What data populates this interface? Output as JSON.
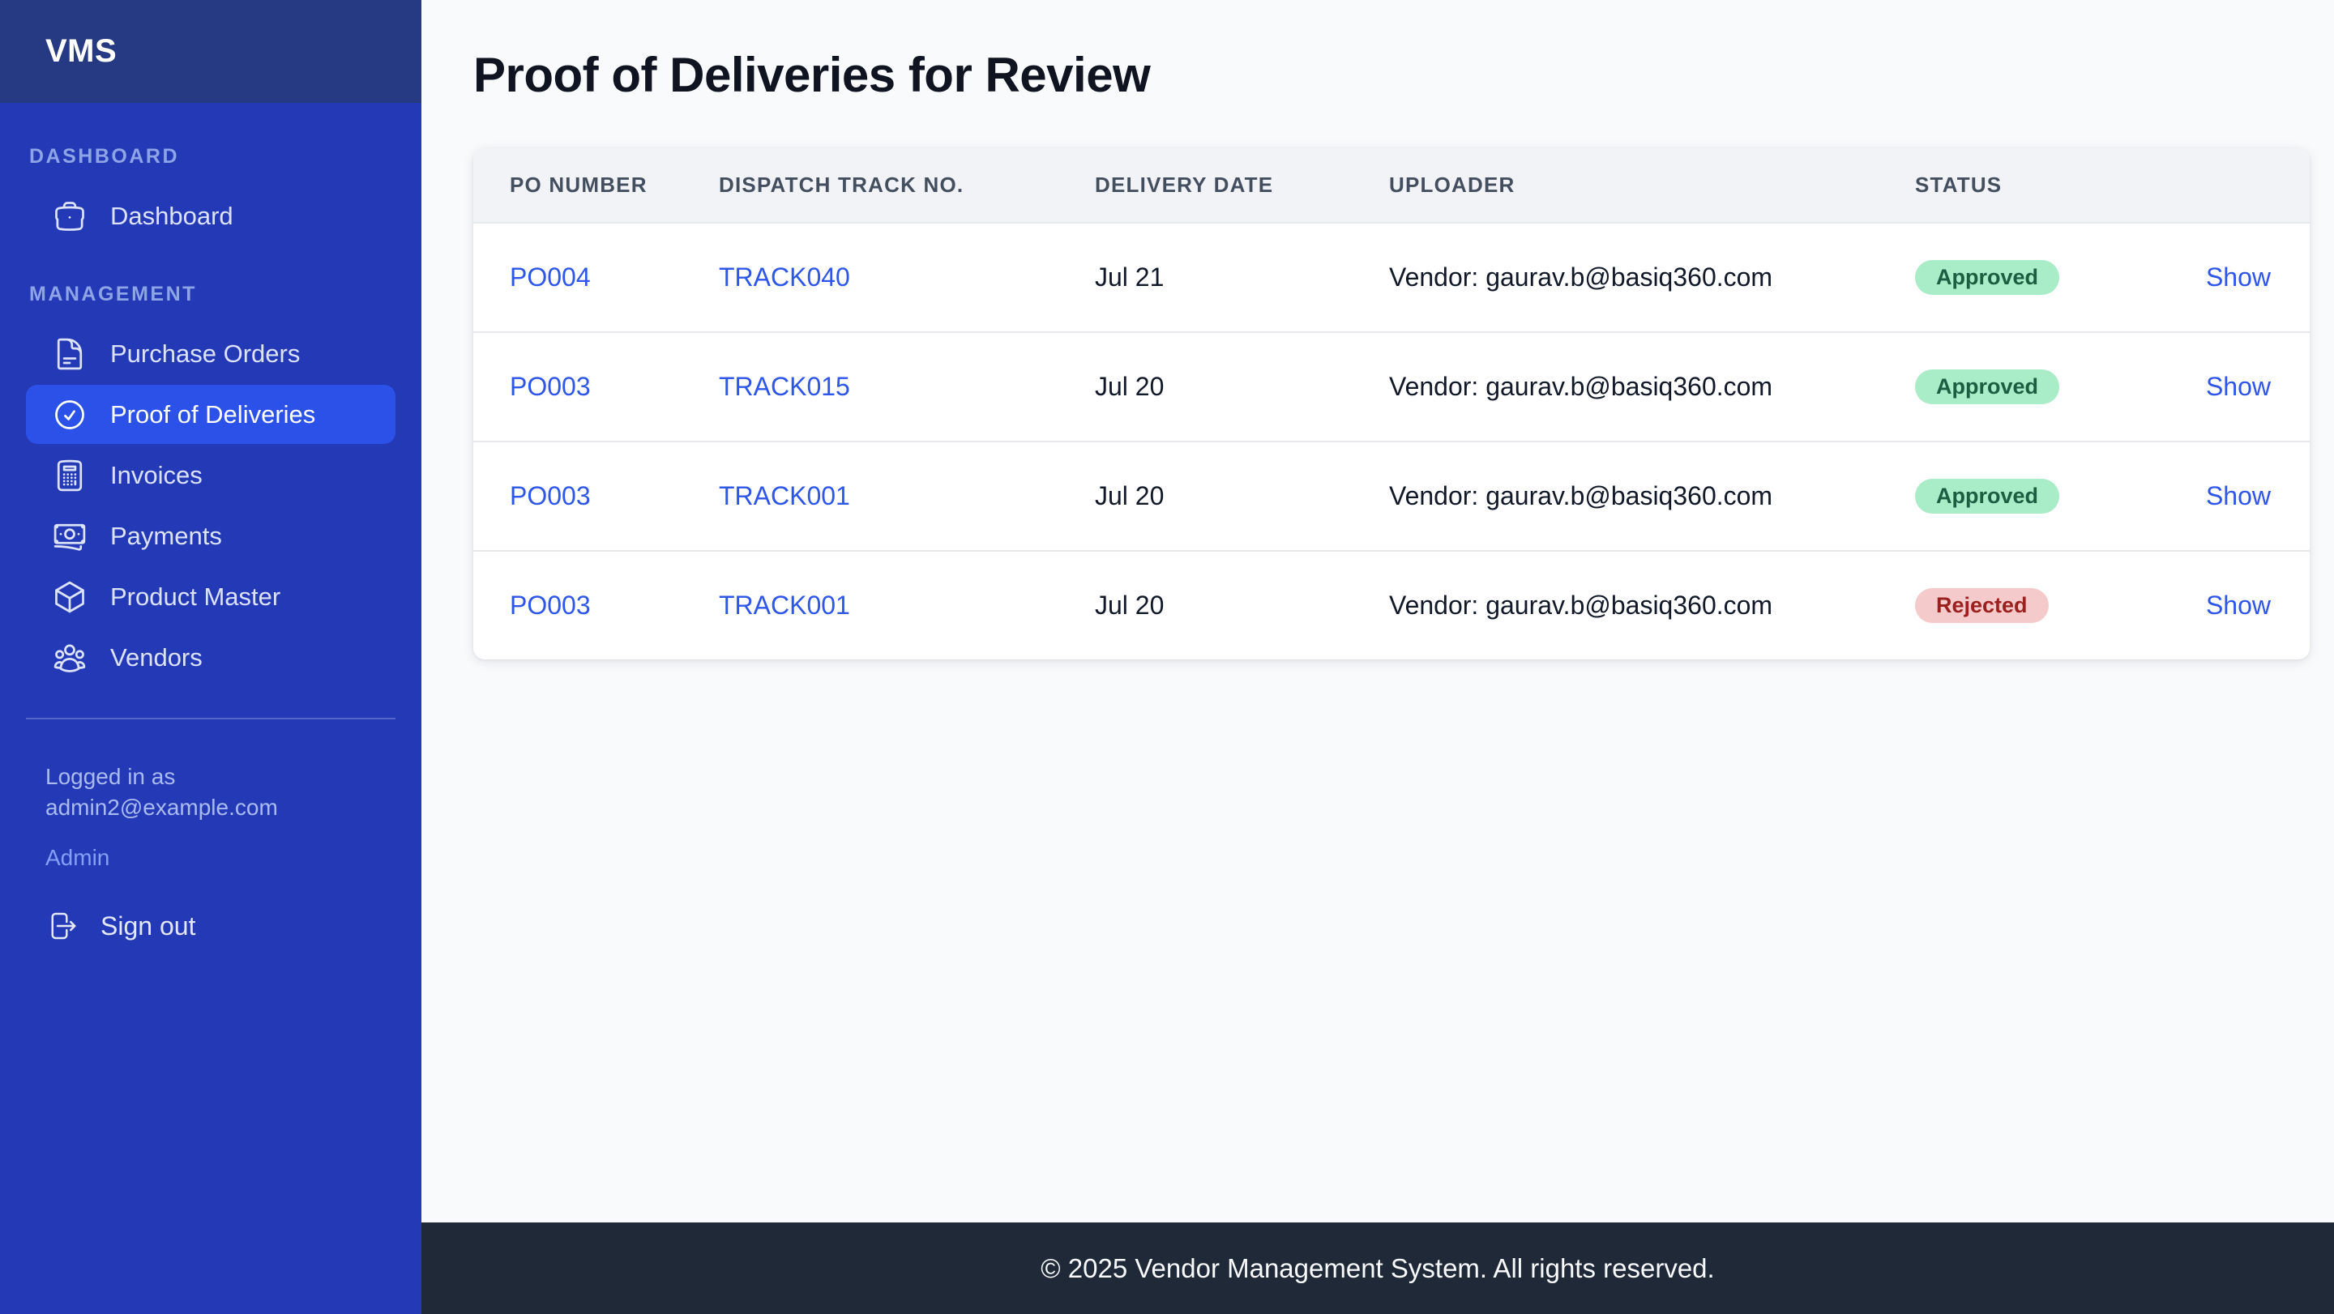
{
  "sidebar": {
    "logo": "VMS",
    "sections": [
      {
        "label": "DASHBOARD",
        "items": [
          {
            "label": "Dashboard",
            "icon": "briefcase-icon",
            "active": false
          }
        ]
      },
      {
        "label": "MANAGEMENT",
        "items": [
          {
            "label": "Purchase Orders",
            "icon": "document-text-icon",
            "active": false
          },
          {
            "label": "Proof of Deliveries",
            "icon": "check-circle-icon",
            "active": true
          },
          {
            "label": "Invoices",
            "icon": "calculator-icon",
            "active": false
          },
          {
            "label": "Payments",
            "icon": "banknotes-icon",
            "active": false
          },
          {
            "label": "Product Master",
            "icon": "cube-icon",
            "active": false
          },
          {
            "label": "Vendors",
            "icon": "users-icon",
            "active": false
          }
        ]
      }
    ],
    "user": {
      "logged_in_label": "Logged in as",
      "email": "admin2@example.com",
      "role": "Admin",
      "sign_out_label": "Sign out",
      "sign_out_icon": "logout-icon"
    }
  },
  "page": {
    "title": "Proof of Deliveries for Review"
  },
  "table": {
    "columns": [
      "PO NUMBER",
      "DISPATCH TRACK NO.",
      "DELIVERY DATE",
      "UPLOADER",
      "STATUS",
      ""
    ],
    "rows": [
      {
        "po_number": "PO004",
        "dispatch_track_no": "TRACK040",
        "delivery_date": "Jul 21",
        "uploader": "Vendor: gaurav.b@basiq360.com",
        "status": "Approved",
        "action": "Show"
      },
      {
        "po_number": "PO003",
        "dispatch_track_no": "TRACK015",
        "delivery_date": "Jul 20",
        "uploader": "Vendor: gaurav.b@basiq360.com",
        "status": "Approved",
        "action": "Show"
      },
      {
        "po_number": "PO003",
        "dispatch_track_no": "TRACK001",
        "delivery_date": "Jul 20",
        "uploader": "Vendor: gaurav.b@basiq360.com",
        "status": "Approved",
        "action": "Show"
      },
      {
        "po_number": "PO003",
        "dispatch_track_no": "TRACK001",
        "delivery_date": "Jul 20",
        "uploader": "Vendor: gaurav.b@basiq360.com",
        "status": "Rejected",
        "action": "Show"
      }
    ]
  },
  "footer": {
    "text": "© 2025 Vendor Management System. All rights reserved."
  },
  "colors": {
    "sidebar": "#2439b6",
    "sidebar_header": "#263a84",
    "active_item": "#2b51e8",
    "link": "#2e56e8",
    "approved_bg": "#a9ecc8",
    "approved_text": "#1c5e41",
    "rejected_bg": "#f5caca",
    "rejected_text": "#9b2020",
    "footer_bg": "#1f2937"
  }
}
